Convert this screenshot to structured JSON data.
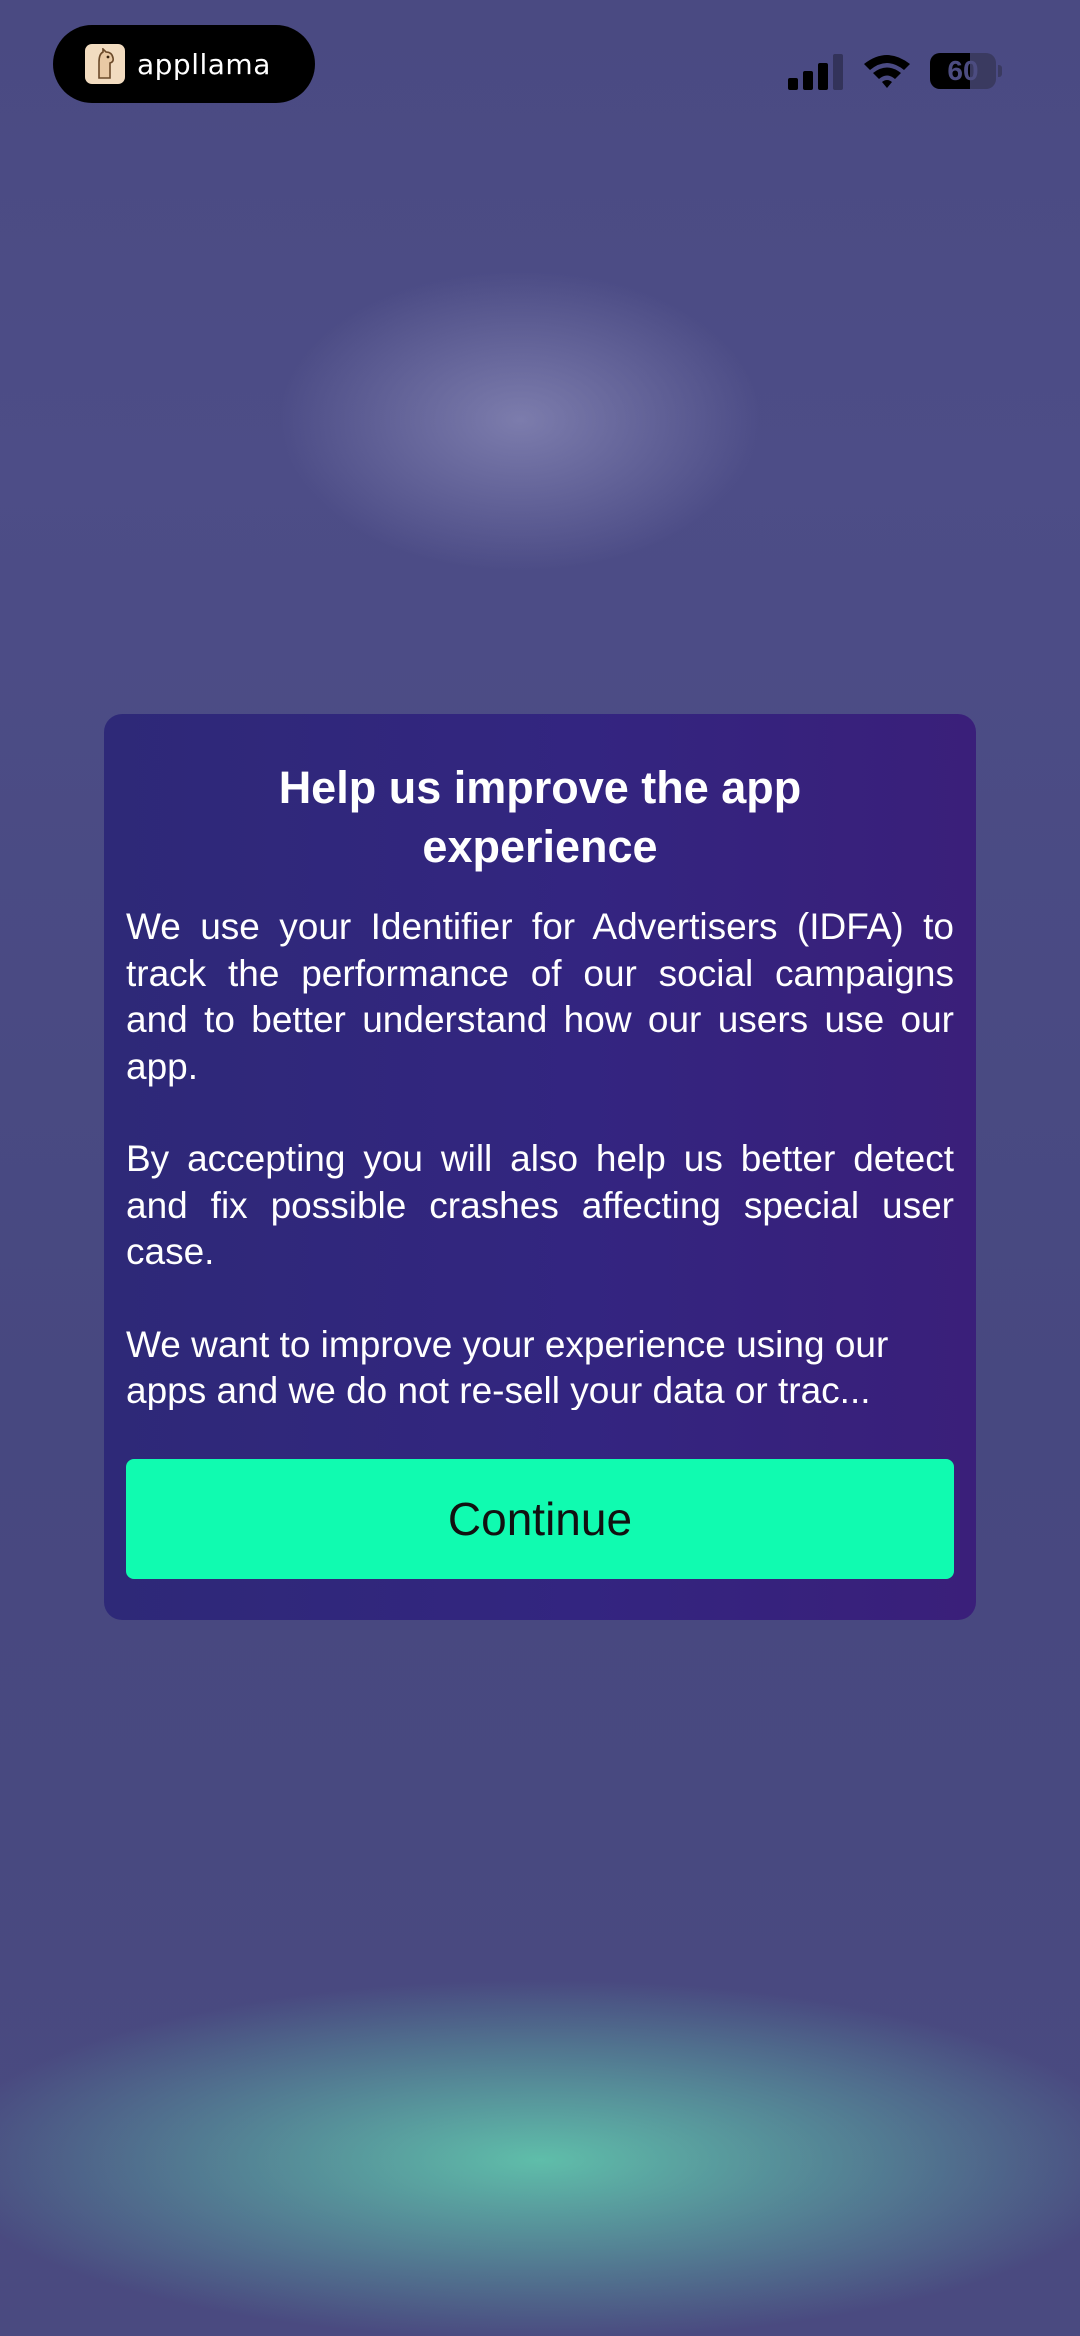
{
  "status_bar": {
    "brand_name": "appllama",
    "battery_level": "60",
    "battery_fraction": 0.6,
    "icons": [
      "llama-logo-icon",
      "cellular-signal-icon",
      "wifi-icon",
      "battery-icon"
    ]
  },
  "dialog": {
    "title": "Help us improve the app experience",
    "paragraphs": [
      "We use your Identifier for Advertisers (IDFA) to track the performance of our social campaigns and to better understand how our users use our app.",
      "By accepting you will also help us better detect and fix possible crashes affecting special user case.",
      "We want to improve your experience using our apps and we do not re-sell  your data or trac..."
    ],
    "continue_label": "Continue"
  },
  "colors": {
    "background": "#4a4a80",
    "dialog": "#332580",
    "accent_button": "#10fbb0",
    "bottom_glow": "#60c4ac"
  }
}
